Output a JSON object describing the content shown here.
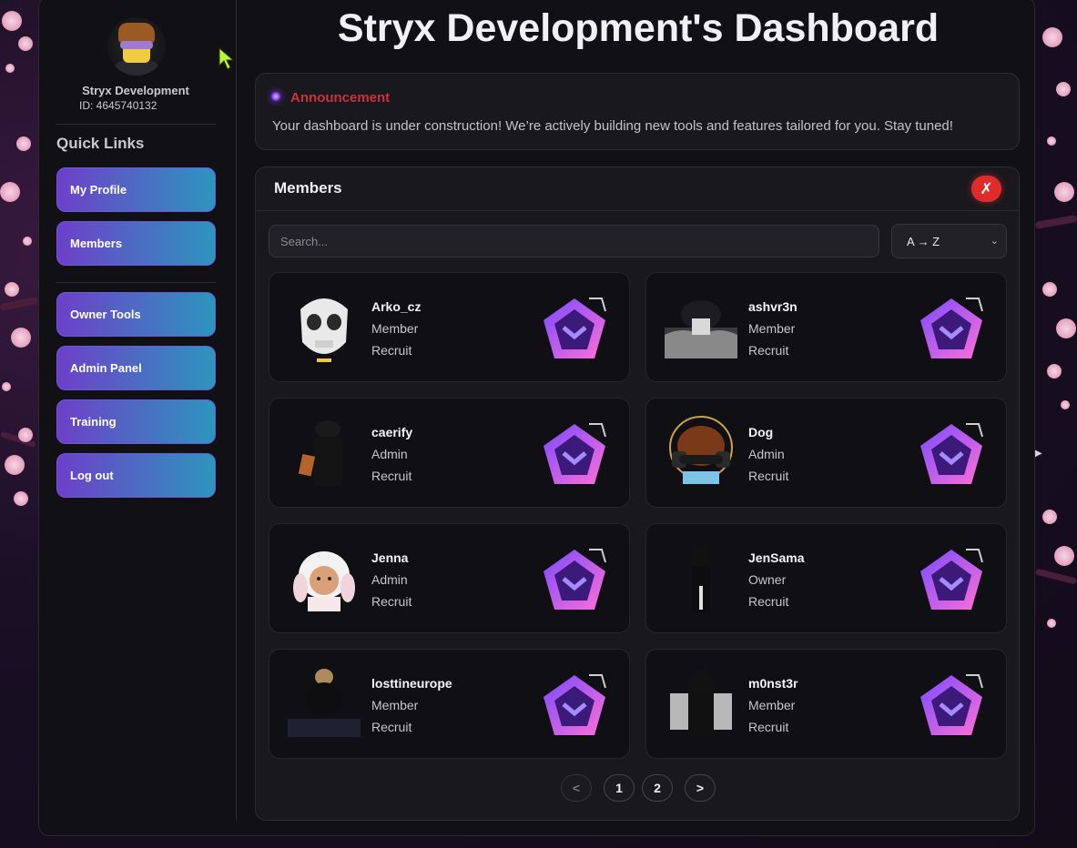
{
  "dashboard_title": "Stryx Development's Dashboard",
  "profile": {
    "name": "Stryx Development",
    "id": "ID: 4645740132"
  },
  "sidebar": {
    "quick_links_title": "Quick Links",
    "links": [
      "My Profile",
      "Members"
    ],
    "tools": [
      "Owner Tools",
      "Admin Panel",
      "Training",
      "Log out"
    ]
  },
  "announcement": {
    "title": "Announcement",
    "text": "Your dashboard is under construction! We’re actively building new tools and features tailored for you. Stay tuned!"
  },
  "members_panel": {
    "title": "Members",
    "close_label": "✗",
    "search_placeholder": "Search...",
    "sort_value": "A → Z",
    "members": [
      {
        "name": "Arko_cz",
        "role": "Member",
        "rank": "Recruit"
      },
      {
        "name": "ashvr3n",
        "role": "Member",
        "rank": "Recruit"
      },
      {
        "name": "caerify",
        "role": "Admin",
        "rank": "Recruit"
      },
      {
        "name": "Dog",
        "role": "Admin",
        "rank": "Recruit"
      },
      {
        "name": "Jenna",
        "role": "Admin",
        "rank": "Recruit"
      },
      {
        "name": "JenSama",
        "role": "Owner",
        "rank": "Recruit"
      },
      {
        "name": "losttineurope",
        "role": "Member",
        "rank": "Recruit"
      },
      {
        "name": "m0nst3r",
        "role": "Member",
        "rank": "Recruit"
      }
    ],
    "pagination": {
      "prev": "<",
      "pages": [
        "1",
        "2"
      ],
      "next": ">"
    }
  },
  "colors": {
    "button_gradient_start": "#6e3fc9",
    "button_gradient_end": "#2d95be",
    "announcement_title": "#c9323f",
    "close_button": "#e02b2b"
  }
}
